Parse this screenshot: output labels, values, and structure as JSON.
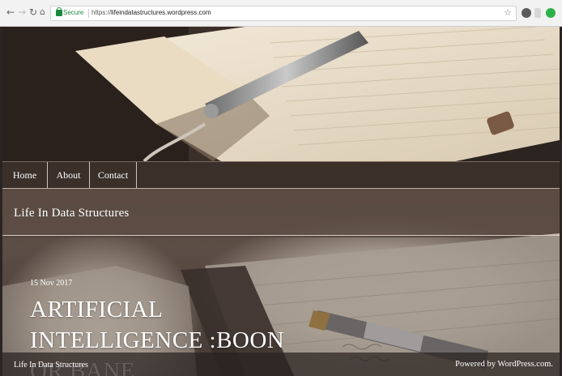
{
  "browser": {
    "back_icon": "arrow-left-icon",
    "forward_icon": "arrow-right-icon",
    "reload_icon": "reload-icon",
    "home_icon": "home-icon",
    "secure_label": "Secure",
    "url_scheme": "https://",
    "url_host": "lifeindatastructures.wordpress.com",
    "star_icon": "star-icon",
    "extension_icons": [
      "extension-icon-1",
      "extension-icon-2",
      "extension-icon-3"
    ]
  },
  "nav": {
    "items": [
      {
        "label": "Home"
      },
      {
        "label": "About"
      },
      {
        "label": "Contact"
      }
    ]
  },
  "site": {
    "title": "Life In Data Structures"
  },
  "post": {
    "date": "15 Nov 2017",
    "title": "ARTIFICIAL INTELLIGENCE :BOON OR BANE"
  },
  "footer": {
    "site_name": "Life In Data Structures",
    "powered_by": "Powered by WordPress.com."
  },
  "colors": {
    "secure_green": "#1a8a3a",
    "nav_bar": "#3c302a"
  }
}
